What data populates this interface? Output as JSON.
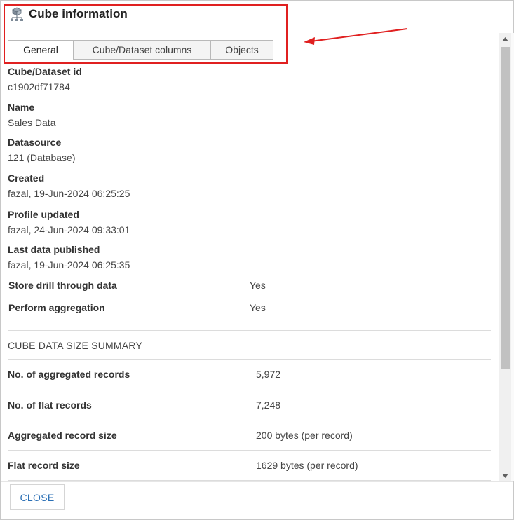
{
  "dialog": {
    "title": "Cube information",
    "title_icon": "cube-hierarchy-icon"
  },
  "tabs": [
    {
      "label": "General",
      "active": true
    },
    {
      "label": "Cube/Dataset columns",
      "active": false
    },
    {
      "label": "Objects",
      "active": false
    }
  ],
  "fields": [
    {
      "label": "Cube/Dataset id",
      "value": "c1902df71784"
    },
    {
      "label": "Name",
      "value": "Sales Data"
    },
    {
      "label": "Datasource",
      "value": "121 (Database)"
    },
    {
      "label": "Created",
      "value": "fazal, 19-Jun-2024 06:25:25"
    },
    {
      "label": "Profile updated",
      "value": "fazal, 24-Jun-2024 09:33:01"
    },
    {
      "label": "Last data published",
      "value": "fazal, 19-Jun-2024 06:25:35"
    }
  ],
  "options": [
    {
      "label": "Store drill through data",
      "value": "Yes"
    },
    {
      "label": "Perform aggregation",
      "value": "Yes"
    }
  ],
  "summary": {
    "heading": "CUBE DATA SIZE SUMMARY",
    "rows": [
      {
        "label": "No. of aggregated records",
        "value": "5,972"
      },
      {
        "label": "No. of flat records",
        "value": "7,248"
      },
      {
        "label": "Aggregated record size",
        "value": "200 bytes (per record)"
      },
      {
        "label": "Flat record size",
        "value": "1629 bytes (per record)"
      }
    ]
  },
  "footer": {
    "close_label": "CLOSE"
  },
  "colors": {
    "annotation": "#e02020",
    "close_text": "#2a6fb5"
  }
}
